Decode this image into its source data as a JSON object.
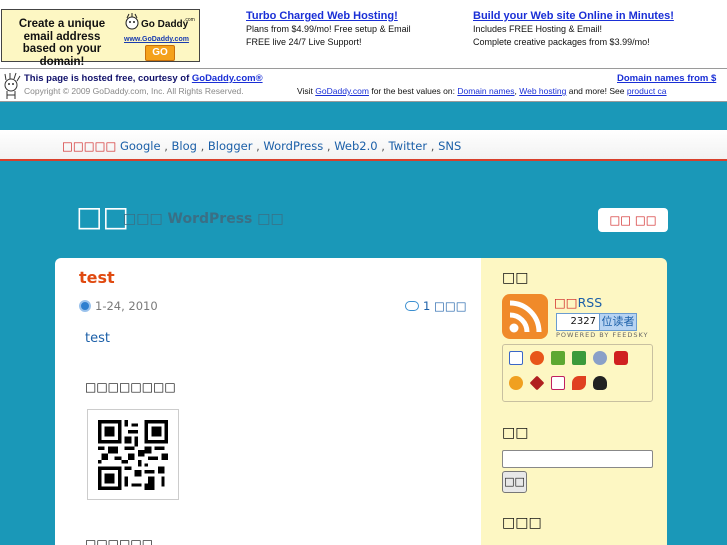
{
  "ad": {
    "box_text": "Create a unique email address based on your domain!",
    "logo_text": "Go Daddy",
    "url_text": "www.GoDaddy.com",
    "go_label": "GO",
    "col1": {
      "heading": "Turbo Charged Web Hosting!",
      "line1": "Plans from $4.99/mo! Free setup & Email",
      "line2": "FREE live 24/7 Live Support!"
    },
    "col2": {
      "heading": "Build your Web site Online in Minutes!",
      "line1": "Includes FREE Hosting & Email!",
      "line2": "Complete creative packages from $3.99/mo!"
    }
  },
  "hosted": {
    "line1_prefix": "This page is hosted free, courtesy of ",
    "line1_link": "GoDaddy.com®",
    "line1_right": "Domain names from $",
    "copyright": "Copyright © 2009 GoDaddy.com, Inc. All Rights Reserved.",
    "visit_prefix": "Visit ",
    "visit_link": "GoDaddy.com",
    "visit_mid": " for the best values on: ",
    "link_domains": "Domain names",
    "comma": ", ",
    "link_hosting": "Web hosting",
    "visit_tail": " and more! See ",
    "link_product": "product ca"
  },
  "nav": {
    "prefix": "□□□□□",
    "items": [
      "Google",
      "Blog",
      "Blogger",
      "WordPress",
      "Web2.0",
      "Twitter",
      "SNS"
    ],
    "separator": ","
  },
  "blog": {
    "title": "□□",
    "description": "□□□ WordPress □□",
    "top_button": "□□ □□"
  },
  "post": {
    "title": "test",
    "date": "1-24, 2010",
    "comments": "1 □□□",
    "body": "test",
    "qr_label": "□□□□□□□□",
    "next_label": "□□□□□□"
  },
  "sidebar": {
    "rss_heading": "□□",
    "rss_prefix": "□□",
    "rss_label": "RSS",
    "reader_count": "2327",
    "reader_label": "位读者",
    "powered": "POWERED BY FEEDSKY",
    "search_heading": "□□",
    "search_button": "□□",
    "third_heading": "□□□"
  },
  "colors": {
    "background": "#1a98b8",
    "post_title": "#e04a10",
    "accent_red": "#d02020",
    "sidebar_bg": "#fdf7c3"
  }
}
